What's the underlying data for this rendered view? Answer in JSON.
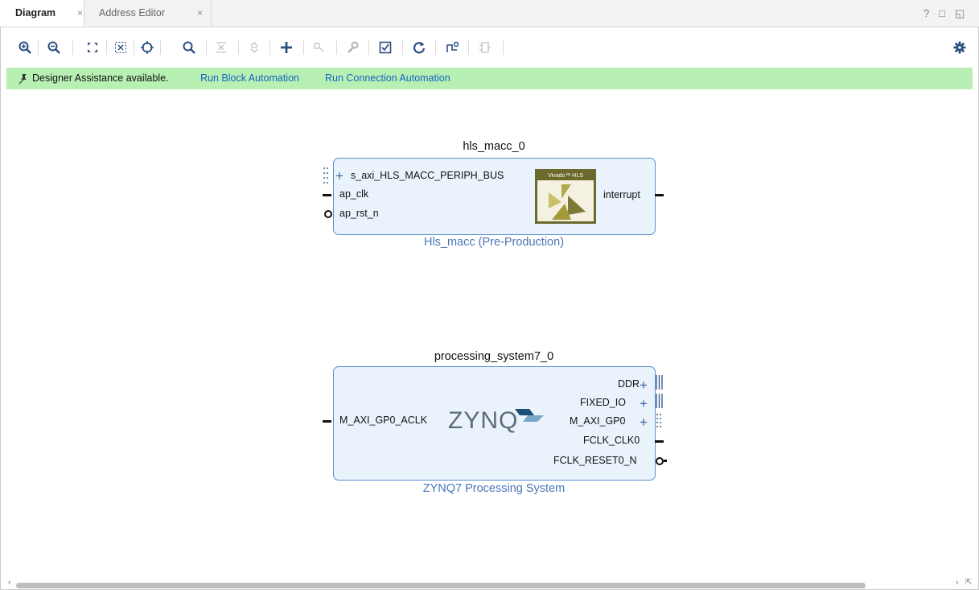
{
  "tabs": [
    {
      "label": "Diagram",
      "active": true
    },
    {
      "label": "Address Editor",
      "active": false
    }
  ],
  "tab_close_glyph": "×",
  "window_controls": {
    "help": "?",
    "restore": "□",
    "maximize": "◱"
  },
  "toolbar": {
    "icons": [
      "zoom-in-icon",
      "zoom-out-icon",
      "fit-icon",
      "fit-selection-icon",
      "center-icon",
      "search-icon",
      "collapse-icon",
      "expand-icon",
      "add-ip-icon",
      "add-port-icon",
      "properties-icon",
      "validate-icon",
      "regenerate-icon",
      "optimize-routing-icon",
      "hierarchy-icon"
    ],
    "settings_icon": "gear-icon"
  },
  "assistance": {
    "pin_glyph": "📌",
    "message": "Designer Assistance available.",
    "link_block": "Run Block Automation",
    "link_connection": "Run Connection Automation"
  },
  "blocks": {
    "hls": {
      "name": "hls_macc_0",
      "subtitle": "Hls_macc (Pre-Production)",
      "ports_left": [
        "s_axi_HLS_MACC_PERIPH_BUS",
        "ap_clk",
        "ap_rst_n"
      ],
      "ports_right": [
        "interrupt"
      ],
      "logo_text": "Vivado™ HLS"
    },
    "zynq": {
      "name": "processing_system7_0",
      "subtitle": "ZYNQ7 Processing System",
      "ports_left": [
        "M_AXI_GP0_ACLK"
      ],
      "ports_right": [
        "DDR",
        "FIXED_IO",
        "M_AXI_GP0",
        "FCLK_CLK0",
        "FCLK_RESET0_N"
      ],
      "logo_text": "ZYNQ"
    }
  },
  "colors": {
    "assist_bg": "#b8f0b4",
    "link": "#1565c0",
    "block_bg": "#eaf3fc",
    "block_border": "#5a8fcf",
    "subtitle": "#4a76b8"
  }
}
